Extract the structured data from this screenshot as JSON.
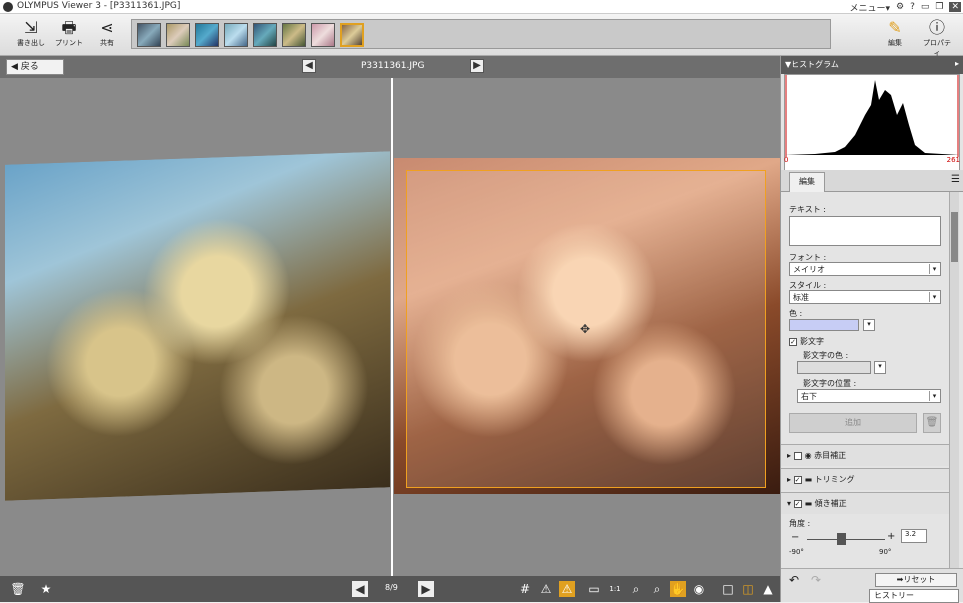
{
  "window": {
    "title": "OLYMPUS Viewer 3 - [P3311361.JPG]",
    "menu_label": "メニュー▾",
    "settings_icon": "gear-icon",
    "help_icon": "help-icon",
    "minimize_icon": "minimize-icon",
    "restore_icon": "restore-icon",
    "close_icon": "close-icon"
  },
  "toolbar": {
    "export_label": "書き出し",
    "print_label": "プリント",
    "share_label": "共有",
    "edit_label": "編集",
    "properties_label": "プロパティ"
  },
  "viewbar": {
    "back_label": "戻る",
    "filename": "P3311361.JPG"
  },
  "status": {
    "page_indicator": "8/9"
  },
  "panel": {
    "histogram_label": "▼ヒストグラム",
    "hist_min": "0",
    "hist_max": "261",
    "tab_edit": "編集",
    "text_label": "テキスト :",
    "font_label": "フォント :",
    "font_value": "メイリオ",
    "style_label": "スタイル :",
    "style_value": "标准",
    "color_label": "色 :",
    "outline_label": "影文字",
    "outline_color_label": "影文字の色 :",
    "outline_pos_label": "影文字の位置 :",
    "outline_pos_value": "右下",
    "add_label": "追加",
    "section_redeye": "赤目補正",
    "section_trimming": "トリミング",
    "section_tilt": "傾き補正",
    "angle_label": "角度 :",
    "angle_value": "3.2",
    "angle_min": "-90°",
    "angle_max": "90°",
    "reset_label": "➡リセット",
    "history_label": "ヒストリー"
  },
  "colors": {
    "text_color": "#c7cdf5",
    "accent": "#e0a020"
  }
}
